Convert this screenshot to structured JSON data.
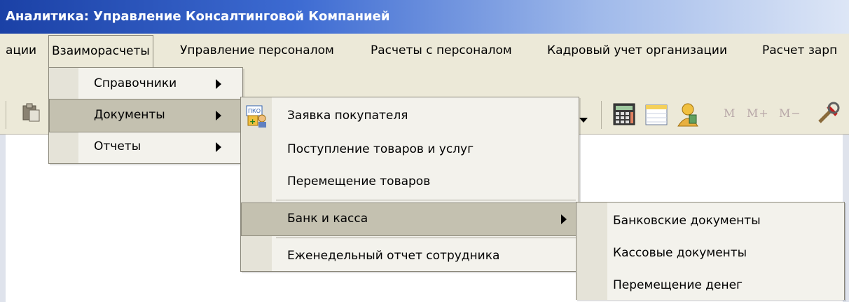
{
  "window": {
    "title": "Аналитика: Управление Консалтинговой Компанией"
  },
  "menubar": {
    "items": [
      "ации",
      "Взаиморасчеты",
      "Управление персоналом",
      "Расчеты с персоналом",
      "Кадровый учет организации",
      "Расчет зарп"
    ]
  },
  "toolbar": {
    "m_buttons": [
      "M",
      "M+",
      "M−"
    ]
  },
  "menu_level1": {
    "items": [
      {
        "label": "Справочники",
        "submenu": true
      },
      {
        "label": "Документы",
        "submenu": true,
        "highlighted": true
      },
      {
        "label": "Отчеты",
        "submenu": true
      }
    ]
  },
  "menu_level2": {
    "items": [
      {
        "label": "Заявка покупателя",
        "icon": "pko-icon"
      },
      {
        "label": "Поступление товаров и услуг"
      },
      {
        "label": "Перемещение товаров"
      },
      {
        "label": "Банк и касса",
        "submenu": true,
        "highlighted": true
      },
      {
        "label": "Еженедельный отчет сотрудника"
      }
    ]
  },
  "menu_level3": {
    "items": [
      {
        "label": "Банковские документы"
      },
      {
        "label": "Кассовые документы"
      },
      {
        "label": "Перемещение денег"
      }
    ]
  },
  "colors": {
    "highlight": "#c4c1b0",
    "menu_bg": "#f3f2ec",
    "title_start": "#1b41a6"
  }
}
